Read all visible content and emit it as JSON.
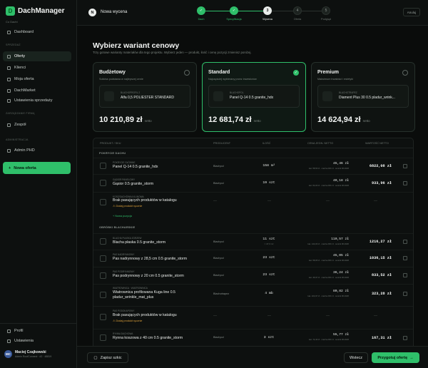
{
  "app": {
    "name": "DachManager",
    "workspace": "Co Dachl"
  },
  "colors": {
    "accent": "#2fbf6a",
    "background": "#0a0c0b",
    "warning": "#e0a23b"
  },
  "sidebar": {
    "sections": [
      {
        "label": "SPRZEDAŻ"
      },
      {
        "label": "ZARZĄDZANIE FIRMĄ"
      },
      {
        "label": "ADMINISTRACJA"
      }
    ],
    "items": [
      {
        "label": "Dashboard",
        "icon": "grid-icon"
      },
      {
        "label": "Oferty",
        "icon": "document-icon"
      },
      {
        "label": "Klienci",
        "icon": "users-icon"
      },
      {
        "label": "Moja oferta",
        "icon": "tag-icon"
      },
      {
        "label": "DachMarket",
        "icon": "store-icon"
      },
      {
        "label": "Ustawienia sprzedaży",
        "icon": "settings-icon"
      },
      {
        "label": "Zespół",
        "icon": "team-icon"
      },
      {
        "label": "Admin PHD",
        "icon": "shield-icon"
      }
    ],
    "new_offer": "Nowa oferta",
    "bottom": [
      {
        "label": "Profil",
        "icon": "user-icon"
      },
      {
        "label": "Ustawienia",
        "icon": "gear-icon"
      }
    ],
    "user": {
      "initials": "MC",
      "name": "Maciej Czajkowski",
      "sub": "Admin RoofConnect · #2 · 48819"
    }
  },
  "topbar": {
    "badge": "N",
    "title": "Nowa wycena",
    "steps": [
      {
        "num": "✓",
        "label": "Dach",
        "state": "done"
      },
      {
        "num": "✓",
        "label": "Specyfikacja",
        "state": "done"
      },
      {
        "num": "3",
        "label": "Wycena",
        "state": "current"
      },
      {
        "num": "4",
        "label": "Oferta",
        "state": "todo"
      },
      {
        "num": "5",
        "label": "Podgląd",
        "state": "todo"
      }
    ],
    "cancel": "Anuluj"
  },
  "main": {
    "title": "Wybierz wariant cenowy",
    "subtitle": "Trzy gotowe warianty materiałów dla tego projektu. Wybierz jeden — produkt, ilość i cenę pozycji zmienisz poniżej.",
    "variants": [
      {
        "name": "Budżetowy",
        "desc": "Solidna podstawa w najlepszej cenie",
        "product_cat": "BLACHOPROFIL 2",
        "product": "Alfa 0,5 POLIESTER STANDARD",
        "price": "10 210,89 zł",
        "net": "netto",
        "selected": false
      },
      {
        "name": "Standard",
        "desc": "Najczęściej wybierany przez inwestorów",
        "product_cat": "BLACHOPOL",
        "product": "Panel Q-14 0.5 granite_hdx",
        "price": "12 681,74 zł",
        "net": "netto",
        "selected": true
      },
      {
        "name": "Premium",
        "desc": "Maksimum trwałości i estetyki",
        "product_cat": "BLACHOTRAPEZ",
        "product": "Diament Plus 30 0.5 pladur_wrink...",
        "price": "14 624,94 zł",
        "net": "netto",
        "selected": false
      }
    ],
    "table": {
      "headers": [
        "PRODUKT / SKU",
        "PRODUCENT",
        "ILOŚĆ",
        "CENA JEDN. NETTO",
        "WARTOŚĆ NETTO"
      ],
      "groups": [
        "POKRYCIE DACHU",
        "OBRÓBKI BLACHARSKIE"
      ],
      "add_link": "+ Nowa pozycja",
      "rows": [
        {
          "cat": "POKRYCIE GŁÓWNE",
          "name": "Panel Q-14 0.5 granite_hdx",
          "prod": "Blachpol",
          "qty": "158 m²",
          "qsub": "",
          "price": "45,46 zł",
          "psub": "kat. 58,50 zł · marża 22% zł · cennik 06.2026",
          "val": "6822,08 zł"
        },
        {
          "cat": "GĄSIOR PANELOWY",
          "name": "Gąsior 0.5 granite_storm",
          "prod": "Blachpol",
          "qty": "19 szt",
          "qsub": "",
          "price": "49,18 zł",
          "psub": "kat. 64,00 zł · marża 23% zł · cennik 06.2026",
          "val": "933,96 zł"
        },
        {
          "cat": "KOSZ/DACHÓWKA KLINOWA",
          "name": "Brak pasujących produktów w katalogu",
          "warn": "⚠ Dodaj produkt ręcznie",
          "prod": "—",
          "qty": "—",
          "price": "—",
          "val": "—"
        },
        {
          "cat": "BLACHA PŁASKA ZGRZEW",
          "name": "Blacha płaska 0.5 granite_storm",
          "prod": "Blachpol",
          "qty": "11 szt",
          "qsub": "≈ 47,3 m²",
          "price": "110,57 zł",
          "psub": "kat. 144,00 zł · marża 23% zł · cennik 06.2026",
          "val": "1216,27 zł"
        },
        {
          "cat": "PAS NADRYNNOWY",
          "name": "Pas nadrynnowy z 28,5 cm 0.5 granite_storm",
          "prod": "Blachpol",
          "qty": "23 szt",
          "qsub": "",
          "price": "45,05 zł",
          "psub": "kat. 58,65 zł · marża 23% zł · cennik 06.2026",
          "val": "1036,15 zł"
        },
        {
          "cat": "PAS PODRYNNOWY",
          "name": "Pas podrynnowy z 20 cm 0.5 granite_storm",
          "prod": "Blachpol",
          "qty": "23 szt",
          "qsub": "",
          "price": "36,24 zł",
          "psub": "kat. 46,97 zł · marża 23% zł · cennik 06.2026",
          "val": "833,52 zł"
        },
        {
          "cat": "WIATROWNICA · WIATROWNICA",
          "name": "Wiatrownica profilowana Kuga line 0.5 pladur_wrinkle_mat_plus",
          "prod": "Blachotrapez",
          "qty": "4 mb",
          "qsub": "",
          "price": "80,82 zł",
          "psub": "kat. 104,97 zł · marża 23% zł · cennik 06.2026",
          "val": "323,28 zł"
        },
        {
          "cat": "PAS PODOKAPOWY",
          "name": "Brak pasujących produktów w katalogu",
          "warn": "⚠ Dodaj produkt ręcznie",
          "prod": "—",
          "qty": "—",
          "price": "—",
          "val": "—"
        },
        {
          "cat": "RYNNA DACHOWA",
          "name": "Rynna koszowa z 40 cm 0.5 granite_storm",
          "prod": "Blachpol",
          "qty": "3 szt",
          "qsub": "",
          "price": "55,77 zł",
          "psub": "kat. 72,43 zł · marża 23% zł · cennik 06.2026",
          "val": "167,31 zł"
        }
      ]
    }
  },
  "footer": {
    "save": "Zapisz szkic",
    "back": "Wstecz",
    "next": "Przygotuj ofertę",
    "next_arrow": "→"
  }
}
